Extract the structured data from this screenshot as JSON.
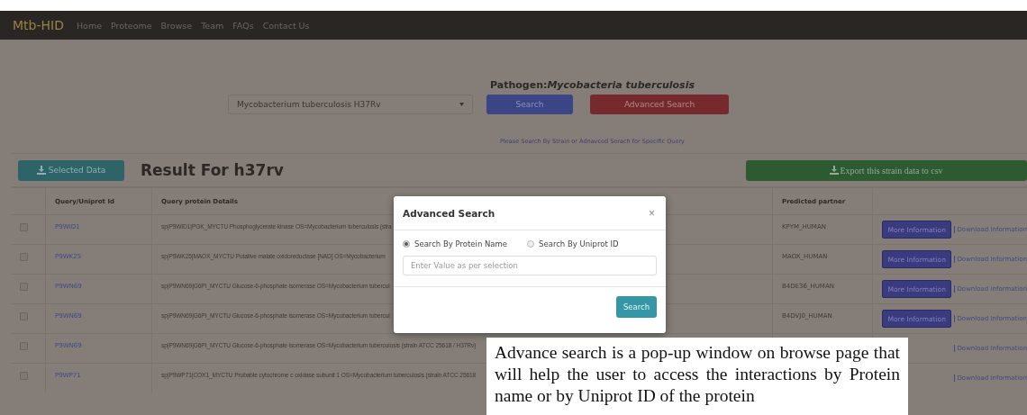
{
  "navbar": {
    "brand": "Mtb-HID",
    "links": [
      "Home",
      "Proteome",
      "Browse",
      "Team",
      "FAQs",
      "Contact Us"
    ]
  },
  "search_panel": {
    "title": "Pathogen:*Mycobacteria tuberculosis*",
    "strain_select": "Mycobacterium tuberculosis H37Rv",
    "search_button": "Search",
    "advanced_button": "Advanced Search",
    "hint": "Please Search By Strain or Adnavced Serach for Specific Query"
  },
  "results": {
    "selected_button": "Selected Data",
    "title": "Result For h37rv",
    "export_button": "Export this strain data to csv",
    "columns": [
      "Query/Uniprot Id",
      "Query protein Details",
      "Predicted partner"
    ],
    "rows": [
      {
        "checked": false,
        "id": "P9WID1",
        "details": "sp|P9WID1|PGK_MYCTU Phosphoglycerate kinase OS=Mycobacterium tuberculosis (stra",
        "partner": "KPYM_HUMAN",
        "more_button": "More Information",
        "download_link": "Download Information"
      },
      {
        "checked": false,
        "id": "P9WK25",
        "details": "sp|P9WK25|MAOX_MYCTU Putative malate oxidoreductase [NAD] OS=Mycobacterium",
        "partner": "MAOX_HUMAN",
        "more_button": "More Information",
        "download_link": "Download Information"
      },
      {
        "checked": false,
        "id": "P9WN69",
        "details": "sp|P9WN69|G6PI_MYCTU Glucose-6-phosphate isomerase OS=Mycobacterium tubercul",
        "partner": "B4DE36_HUMAN",
        "more_button": "More Information",
        "download_link": "Download Information"
      },
      {
        "checked": false,
        "id": "P9WN69",
        "details": "sp|P9WN69|G6PI_MYCTU Glucose-6-phosphate isomerase OS=Mycobacterium tubercul",
        "partner": "B4DVJ0_HUMAN",
        "more_button": "More Information",
        "download_link": "Download Information"
      },
      {
        "checked": false,
        "id": "P9WN69",
        "details": "sp|P9WN69|G6PI_MYCTU Glucose-6-phosphate isomerase OS=Mycobacterium tuberculosis (strain ATCC 25618 / H37Rv)",
        "download_link": "Download Information"
      },
      {
        "checked": false,
        "id": "P9WP71",
        "details": "sp|P9WP71|COX1_MYCTU Probable cytochrome c oxidase subunit 1 OS=Mycobacterium tuberculosis (strain ATCC 25618",
        "download_link": "Download Information"
      }
    ]
  },
  "modal": {
    "title": "Advanced Search",
    "close": "×",
    "options": [
      {
        "label": "Search By Protein Name",
        "selected": true
      },
      {
        "label": "Search By Uniprot ID",
        "selected": false
      }
    ],
    "placeholder": "Enter Value as per selection",
    "search_button": "Search"
  },
  "annotation": "Advance search is a pop-up window on browse page that will help the user to access the interactions by Protein name or by Uniprot ID of the protein"
}
